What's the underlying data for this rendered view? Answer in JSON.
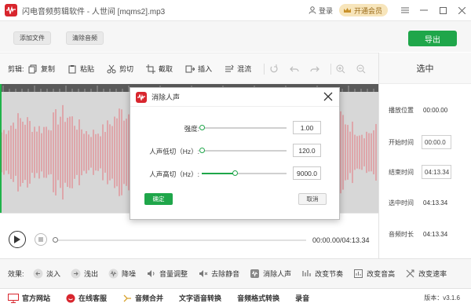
{
  "titlebar": {
    "app_name": "闪电音频剪辑软件 - 人世间 [mqms2].mp3",
    "login": "登录",
    "vip": "开通会员"
  },
  "toolbar": {
    "add_file": "添加文件",
    "clear_audio": "清除音频",
    "export": "导出"
  },
  "edit": {
    "label": "剪辑:",
    "tools": [
      "复制",
      "粘贴",
      "剪切",
      "截取",
      "插入",
      "混流"
    ]
  },
  "side": {
    "title": "选中",
    "play_pos_label": "播放位置",
    "play_pos_value": "00:00.00",
    "start_label": "开始时间",
    "start_value": "00:00.0",
    "end_label": "结束时间",
    "end_value": "04:13.34",
    "selected_label": "选中时间",
    "selected_value": "04:13.34",
    "duration_label": "音频时长",
    "duration_value": "04:13.34"
  },
  "player": {
    "time": "00:00.00/04:13.34",
    "progress": 0
  },
  "effects": {
    "label": "效果:",
    "items": [
      "淡入",
      "浅出",
      "降噪",
      "音量调整",
      "去除静音",
      "消除人声",
      "改变节奏",
      "改变音高",
      "改变速率"
    ]
  },
  "footer": {
    "items": [
      "官方网站",
      "在线客服",
      "音频合并",
      "文字语音转换",
      "音频格式转换",
      "录音"
    ],
    "version": "版本：v3.1.6"
  },
  "dialog": {
    "title": "消除人声",
    "rows": [
      {
        "label": "强度:",
        "value": "1.00",
        "level": 0.0
      },
      {
        "label": "人声低切（Hz）:",
        "value": "120.0",
        "level": 0.0
      },
      {
        "label": "人声高切（Hz）:",
        "value": "9000.0",
        "level": 0.39
      }
    ],
    "ok": "确定",
    "cancel": "取消"
  },
  "colors": {
    "brand_red": "#d8262e",
    "accent_green": "#1fa64a",
    "wave": "#e3858c",
    "wave_bg": "#d7d7d7"
  }
}
